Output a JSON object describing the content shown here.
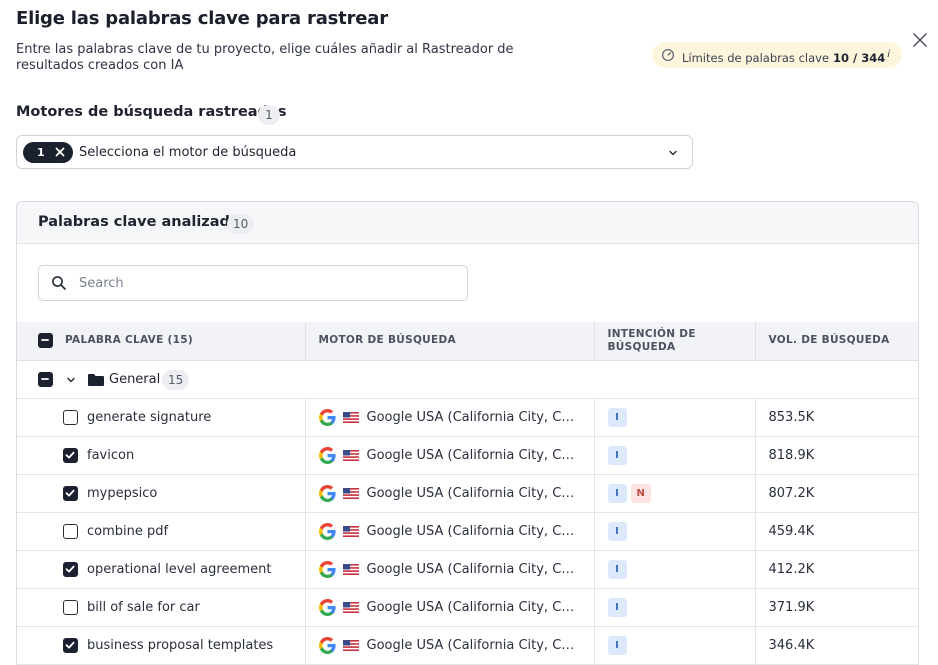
{
  "dialog": {
    "title": "Elige las palabras clave para rastrear",
    "subtitle": "Entre las palabras clave de tu proyecto, elige cuáles añadir al Rastreador de resultados creados con IA",
    "limits_label": "Límites de palabras clave",
    "limits_value": "10 / 344",
    "limits_info": "i"
  },
  "engines": {
    "label": "Motores de búsqueda rastreados",
    "count": "1",
    "chip_count": "1",
    "placeholder": "Selecciona el motor de búsqueda"
  },
  "panel": {
    "title": "Palabras clave analizadas",
    "count": "10",
    "search_placeholder": "Search"
  },
  "table": {
    "headers": [
      "PALABRA CLAVE (15)",
      "MOTOR DE BÚSQUEDA",
      "INTENCIÓN DE BÚSQUEDA",
      "VOL. DE BÚSQUEDA"
    ],
    "group": {
      "name": "General",
      "count": "15"
    },
    "rows": [
      {
        "keyword": "generate signature",
        "checked": false,
        "engine": "Google USA (California City, California, United States)",
        "intents": [
          "I"
        ],
        "volume": "853.5K"
      },
      {
        "keyword": "favicon",
        "checked": true,
        "engine": "Google USA (California City, California, United States)",
        "intents": [
          "I"
        ],
        "volume": "818.9K"
      },
      {
        "keyword": "mypepsico",
        "checked": true,
        "engine": "Google USA (California City, California, United States)",
        "intents": [
          "I",
          "N"
        ],
        "volume": "807.2K"
      },
      {
        "keyword": "combine pdf",
        "checked": false,
        "engine": "Google USA (California City, California, United States)",
        "intents": [
          "I"
        ],
        "volume": "459.4K"
      },
      {
        "keyword": "operational level agreement",
        "checked": true,
        "engine": "Google USA (California City, California, United States)",
        "intents": [
          "I"
        ],
        "volume": "412.2K"
      },
      {
        "keyword": "bill of sale for car",
        "checked": false,
        "engine": "Google USA (California City, California, United States)",
        "intents": [
          "I"
        ],
        "volume": "371.9K"
      },
      {
        "keyword": "business proposal templates",
        "checked": true,
        "engine": "Google USA (California City, California, United States)",
        "intents": [
          "I"
        ],
        "volume": "346.4K"
      }
    ]
  },
  "colors": {
    "accent_dark": "#1c2130",
    "limits_bg": "#fdf6dc",
    "intent_informational": "#dbe9fa",
    "intent_navigational": "#fde3e1"
  },
  "icons": {
    "close": "close-icon",
    "gauge": "gauge-icon",
    "search": "search-icon",
    "chevron": "chevron-down-icon",
    "folder": "folder-icon",
    "google": "google-icon",
    "flag": "us-flag-icon"
  }
}
